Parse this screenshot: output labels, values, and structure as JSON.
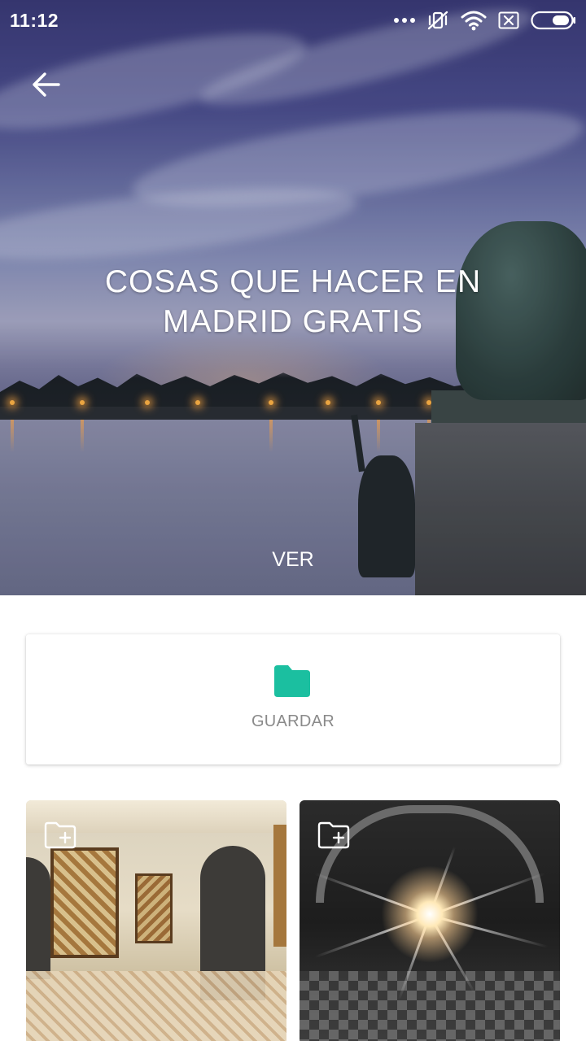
{
  "status_bar": {
    "time": "11:12",
    "icons": [
      "more-dots-icon",
      "vibrate-off-icon",
      "wifi-icon",
      "sim-x-icon",
      "battery-icon"
    ]
  },
  "hero": {
    "title": "COSAS QUE HACER EN MADRID GRATIS",
    "view_label": "VER",
    "back_icon": "back-arrow-icon"
  },
  "save_card": {
    "label": "GUARDAR",
    "icon": "folder-icon",
    "accent": "#1BBFA0"
  },
  "gallery": {
    "items": [
      {
        "icon": "folder-add-icon",
        "scene": "museum-mosaics"
      },
      {
        "icon": "folder-add-icon",
        "scene": "light-installation"
      }
    ]
  }
}
